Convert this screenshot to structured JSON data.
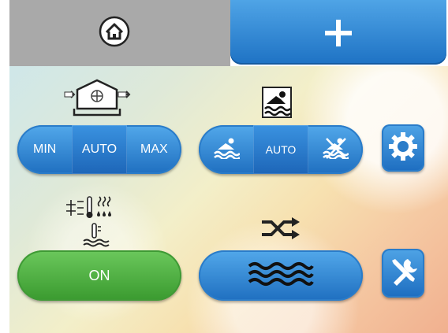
{
  "tabs": {
    "home_icon": "home-icon",
    "add_icon": "plus-icon"
  },
  "ventilation": {
    "icon": "ventilation-unit-icon",
    "options": [
      "MIN",
      "AUTO",
      "MAX"
    ],
    "selected": "AUTO"
  },
  "pool": {
    "icon": "swimmer-icon",
    "options": [
      "pool-heat-icon",
      "AUTO",
      "pool-off-icon"
    ],
    "auto_label": "AUTO",
    "selected": "AUTO"
  },
  "heating": {
    "icon": "heating-dehumidify-icon",
    "button_label": "ON",
    "state_color": "#4caf3f"
  },
  "circulation": {
    "icon": "shuffle-icon",
    "button_icon": "water-waves-icon"
  },
  "side_buttons": {
    "settings_icon": "gear-icon",
    "service_icon": "tools-icon"
  },
  "colors": {
    "accent": "#1f6fc0",
    "on_green": "#4caf3f",
    "tab_gray": "#a9a9a9"
  }
}
